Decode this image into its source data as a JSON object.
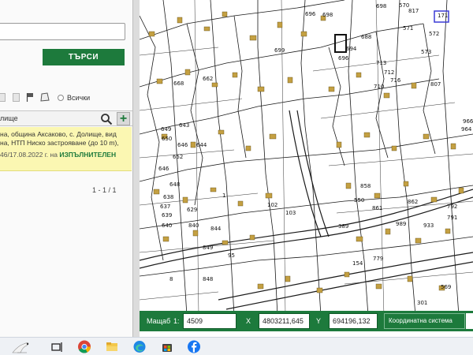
{
  "left_panel": {
    "search_button_label": "ТЪРСИ",
    "filter_all_label": "Всички",
    "result_search_term": "лище",
    "result_card": {
      "line1": "на, община Аксаково, с. Долище, вид",
      "line2": "на, НТП Ниско застрояване (до 10 m),",
      "doc": "46/17.08.2022 г.",
      "doc_suffix": "на",
      "status": "ИЗПЪЛНИТЕЛЕН"
    },
    "pager": "1 - 1 / 1"
  },
  "map": {
    "labels": [
      "696",
      "698",
      "698",
      "570",
      "817",
      "171",
      "572",
      "571",
      "573",
      "807",
      "699",
      "688",
      "694",
      "696",
      "668",
      "662",
      "712",
      "716",
      "710",
      "713",
      "649",
      "650",
      "643",
      "646",
      "644",
      "652",
      "646",
      "648",
      "638",
      "639",
      "640",
      "637",
      "629",
      "840",
      "844",
      "849",
      "848",
      "95",
      "8",
      "1",
      "103",
      "102",
      "550",
      "858",
      "861",
      "862",
      "154",
      "779",
      "989",
      "933",
      "792",
      "791",
      "966",
      "964",
      "569",
      "389",
      "301"
    ],
    "parcel_colors": {
      "building": "#c4a042",
      "line": "#1a1a1a",
      "road": "#ffffff"
    },
    "highlight_color": "#3b3bd6"
  },
  "coord_bar": {
    "scale_label": "Мащаб",
    "scale_sep": "1:",
    "scale_value": "4509",
    "x_label": "X",
    "x_value": "4803211,645",
    "y_label": "Y",
    "y_value": "694196,132",
    "system_label": "Координатна система"
  },
  "taskbar": {
    "icons": [
      "bird-logo-icon",
      "task-view-icon",
      "chrome-icon",
      "file-explorer-icon",
      "edge-icon",
      "store-icon",
      "facebook-icon"
    ]
  }
}
